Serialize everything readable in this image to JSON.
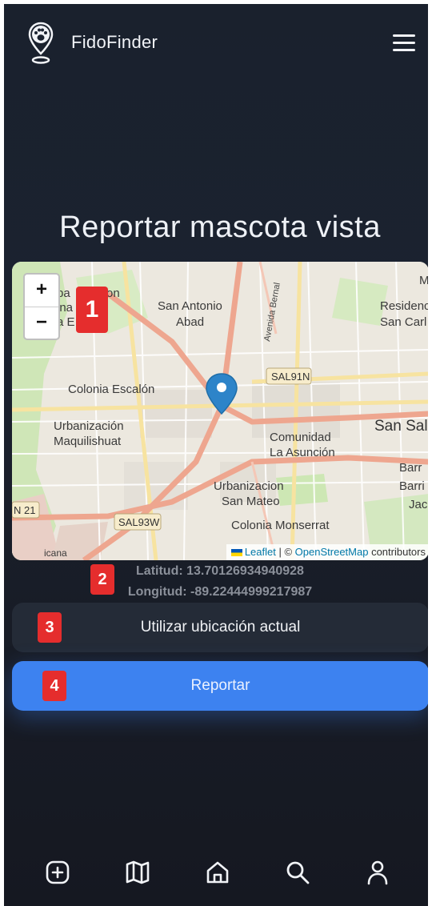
{
  "app": {
    "name": "FidoFinder"
  },
  "header": {
    "logo_icon": "paw-pin-icon",
    "menu_icon": "hamburger-menu-icon"
  },
  "page": {
    "title": "Reportar mascota vista"
  },
  "map": {
    "zoom_in": "+",
    "zoom_out": "−",
    "labels": {
      "san_antonio": "San Antonio",
      "abad": "Abad",
      "avenida_bernal": "Avenida Bernal",
      "residencial": "Residenc",
      "san_carlos": "San Carl",
      "m_edge": "M",
      "sal91n": "SAL91N",
      "colonia_escalon": "Colonia Escalón",
      "urbanizacion_maq_1": "Urbanización",
      "urbanizacion_maq_2": "Maquilishuat",
      "comunidad": "Comunidad",
      "la_asuncion": "La Asunción",
      "san_salvador": "San Sal",
      "urbanizacion_sm_1": "Urbanizacion",
      "urbanizacion_sm_2": "San Mateo",
      "colonia_monserrat": "Colonia Monserrat",
      "sal93w": "SAL93W",
      "n21": "N 21",
      "barr1": "Barr",
      "barr2": "Barri",
      "jac": "Jac",
      "left_edge_1": "ba",
      "left_edge_2": "ina",
      "left_edge_3": "a E",
      "on": "on",
      "icana": "icana"
    },
    "attribution": {
      "leaflet": "Leaflet",
      "separator": " | © ",
      "osm": "OpenStreetMap",
      "contributors": " contributors"
    }
  },
  "coords": {
    "latitude": "Latitud: 13.70126934940928",
    "longitude": "Longitud: -89.22444999217987"
  },
  "buttons": {
    "use_location": "Utilizar ubicación actual",
    "report": "Reportar"
  },
  "annotations": [
    "1",
    "2",
    "3",
    "4"
  ],
  "bottom_nav": [
    {
      "icon": "plus-square-icon"
    },
    {
      "icon": "map-icon"
    },
    {
      "icon": "home-icon"
    },
    {
      "icon": "search-icon"
    },
    {
      "icon": "user-icon"
    }
  ],
  "colors": {
    "background": "#1b2230",
    "accent": "#3d82f0",
    "badge": "#e52d2d"
  }
}
